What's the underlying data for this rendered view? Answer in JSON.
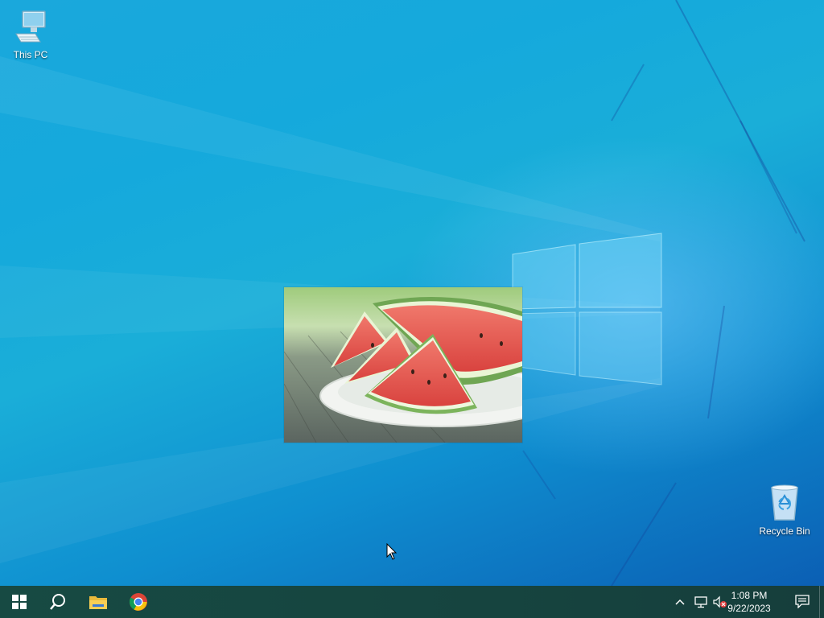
{
  "desktop": {
    "icons": [
      {
        "label": "This PC",
        "icon": "computer-icon"
      },
      {
        "label": "Recycle Bin",
        "icon": "recycle-bin-icon"
      }
    ],
    "photo_window": {
      "subject": "watermelon-photo"
    }
  },
  "taskbar": {
    "pinned": [
      {
        "name": "start",
        "icon": "windows-logo-icon"
      },
      {
        "name": "search",
        "icon": "search-icon"
      },
      {
        "name": "file-explorer",
        "icon": "folder-icon"
      },
      {
        "name": "chrome",
        "icon": "chrome-icon"
      }
    ],
    "tray": {
      "icons": [
        "chevron-up-icon",
        "network-icon",
        "speaker-muted-icon"
      ],
      "time": "1:08 PM",
      "date": "9/22/2023"
    },
    "notification_icon": "notification-icon"
  },
  "colors": {
    "taskbar": "#16463f",
    "desktop_light": "#1aa8dc",
    "desktop_dark": "#0b5fb4"
  }
}
